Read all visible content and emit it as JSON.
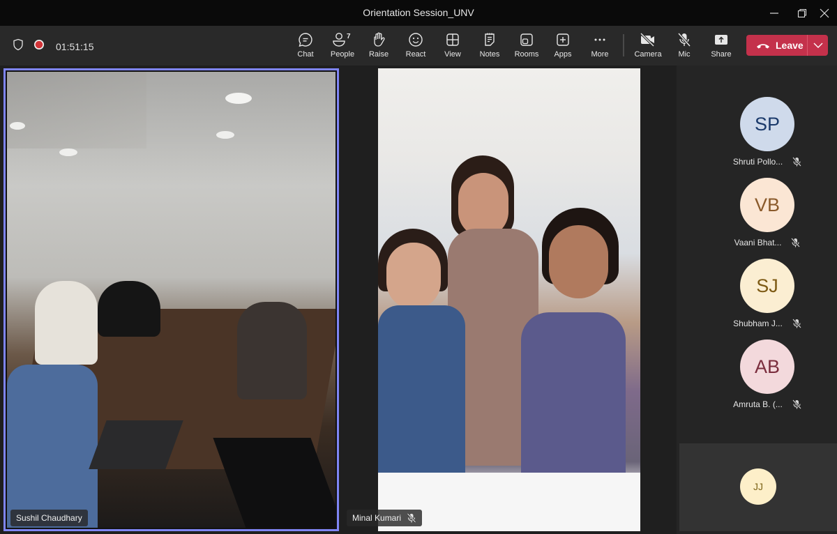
{
  "window": {
    "title": "Orientation Session_UNV",
    "controls": [
      "minimize",
      "restore",
      "close"
    ]
  },
  "toolbar": {
    "security_icon": "shield-icon",
    "recording_icon": "recording-dot-icon",
    "timer": "01:51:15",
    "buttons": [
      {
        "id": "chat",
        "label": "Chat",
        "icon": "chat-icon"
      },
      {
        "id": "people",
        "label": "People",
        "icon": "people-icon",
        "badge": "7"
      },
      {
        "id": "raise",
        "label": "Raise",
        "icon": "raise-hand-icon"
      },
      {
        "id": "react",
        "label": "React",
        "icon": "smiley-icon"
      },
      {
        "id": "view",
        "label": "View",
        "icon": "grid-view-icon"
      },
      {
        "id": "notes",
        "label": "Notes",
        "icon": "notes-icon"
      },
      {
        "id": "rooms",
        "label": "Rooms",
        "icon": "rooms-icon"
      },
      {
        "id": "apps",
        "label": "Apps",
        "icon": "apps-plus-icon"
      },
      {
        "id": "more",
        "label": "More",
        "icon": "more-dots-icon"
      },
      {
        "id": "camera",
        "label": "Camera",
        "icon": "camera-off-icon"
      },
      {
        "id": "mic",
        "label": "Mic",
        "icon": "mic-off-icon"
      },
      {
        "id": "share",
        "label": "Share",
        "icon": "share-tray-icon"
      }
    ],
    "leave_label": "Leave",
    "accent_leave": "#c4314b"
  },
  "stage": {
    "tiles": [
      {
        "name": "Sushil Chaudhary",
        "muted": false,
        "active_speaker": true
      },
      {
        "name": "Minal Kumari",
        "muted": true,
        "active_speaker": false
      }
    ],
    "active_border_color": "#7f85f5"
  },
  "roster": {
    "participants": [
      {
        "initials": "SP",
        "name": "Shruti Pollo...",
        "muted": true,
        "bg": "#cfdaeb",
        "fg": "#1b3a6b"
      },
      {
        "initials": "VB",
        "name": "Vaani Bhat...",
        "muted": true,
        "bg": "#fbe6d4",
        "fg": "#8a5a2b"
      },
      {
        "initials": "SJ",
        "name": "Shubham J...",
        "muted": true,
        "bg": "#fbeed2",
        "fg": "#7d5a14"
      },
      {
        "initials": "AB",
        "name": "Amruta B. (...",
        "muted": true,
        "bg": "#f3d9dc",
        "fg": "#7a2d3d"
      }
    ],
    "self_tile": {
      "initials": "JJ",
      "bg": "#fdefc9",
      "fg": "#7d6418"
    }
  }
}
